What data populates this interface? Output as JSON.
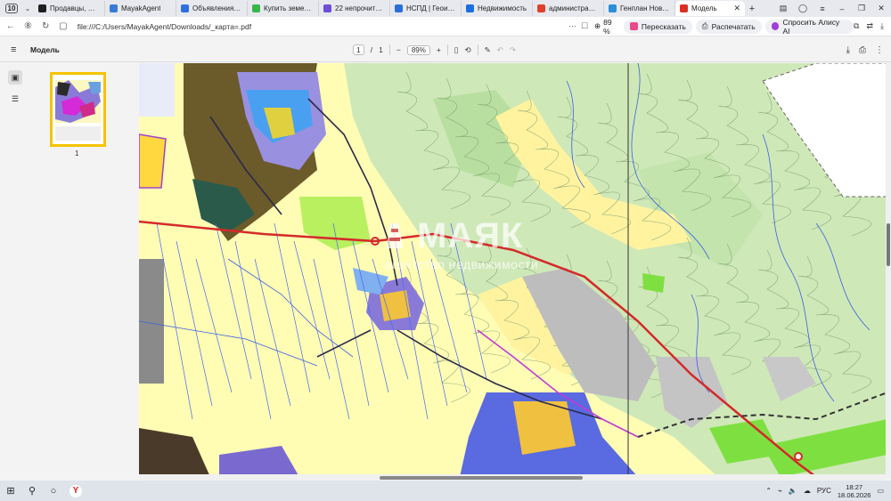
{
  "browser": {
    "tab_count": "10",
    "tabs": [
      {
        "title": "Продавцы, Мои о",
        "color": "#1f1f1f"
      },
      {
        "title": "MayakAgent",
        "color": "#3a7bd5"
      },
      {
        "title": "Объявления недв",
        "color": "#2f6fde"
      },
      {
        "title": "Купить земельны",
        "color": "#39b54a"
      },
      {
        "title": "22 непрочитанны",
        "color": "#6b4fd8"
      },
      {
        "title": "НСПД | Геоинфор",
        "color": "#2a6fd8"
      },
      {
        "title": "Недвижимость",
        "color": "#1b6fe0"
      },
      {
        "title": "администрация",
        "color": "#e0402a"
      },
      {
        "title": "Генплан Новорос",
        "color": "#2a8fd8"
      },
      {
        "title": "Модель",
        "color": "#d93025"
      }
    ],
    "url": "file:///C:/Users/MayakAgent/Downloads/_карта=.pdf",
    "zoom": "89 %",
    "translate_label": "Пересказать",
    "print_label": "Распечатать",
    "alice_label": "Спросить Алису AI"
  },
  "pdf": {
    "title": "Модель",
    "page_current": "1",
    "page_sep": "/",
    "page_total": "1",
    "zoom": "89%",
    "thumb_label": "1"
  },
  "map": {
    "watermark_title": "МАЯК",
    "watermark_subtitle": "агентство недвижимости"
  },
  "taskbar": {
    "lang": "РУС",
    "time": "18:27",
    "date": "18.06.2026"
  }
}
